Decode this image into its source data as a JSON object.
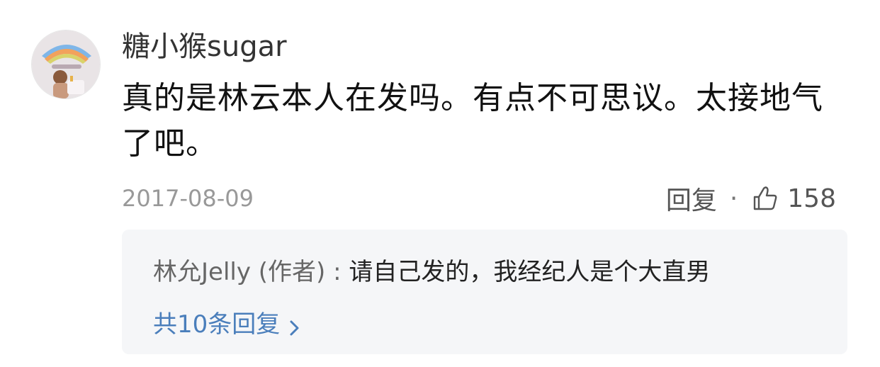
{
  "comment": {
    "username": "糖小猴sugar",
    "text": "真的是林云本人在发吗。有点不可思议。太接地气了吧。",
    "date": "2017-08-09",
    "reply_label": "回复",
    "separator": "·",
    "like_count": "158",
    "avatar_icon": "user-avatar"
  },
  "reply_preview": {
    "author": "林允Jelly (作者) : ",
    "content": "请自己发的，我经纪人是个大直男",
    "more_label": "共10条回复",
    "link_color": "#4a7ebb"
  },
  "icons": {
    "like": "thumbs-up-icon",
    "more": "chevron-right-icon"
  }
}
